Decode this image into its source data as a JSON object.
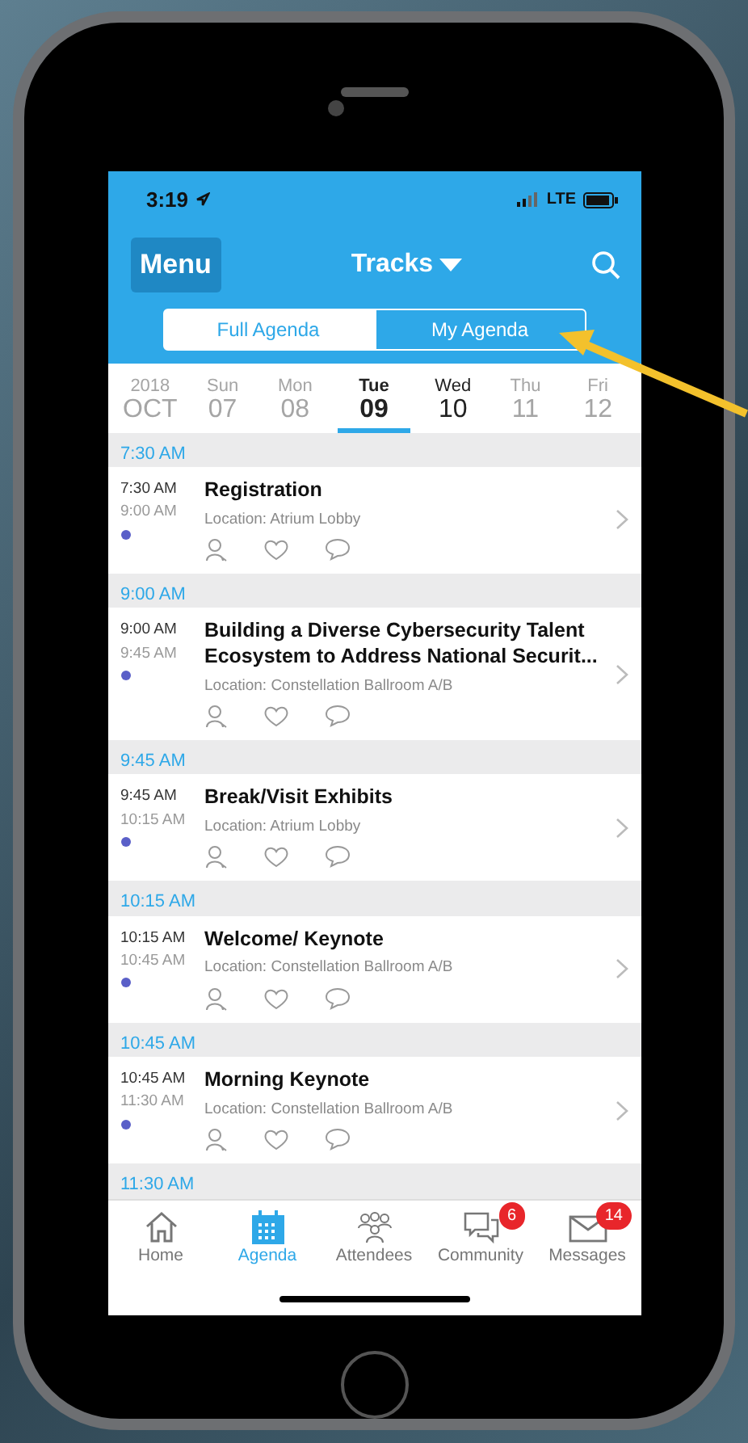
{
  "status_bar": {
    "time": "3:19",
    "network": "LTE"
  },
  "header": {
    "menu_button": "Menu",
    "title": "Tracks"
  },
  "segments": [
    {
      "label": "Full Agenda",
      "selected": true
    },
    {
      "label": "My Agenda",
      "selected": false
    }
  ],
  "date_strip": {
    "year": "2018",
    "month": "OCT",
    "days": [
      {
        "weekday": "Sun",
        "day": "07",
        "selected": false,
        "has_events": false
      },
      {
        "weekday": "Mon",
        "day": "08",
        "selected": false,
        "has_events": false
      },
      {
        "weekday": "Tue",
        "day": "09",
        "selected": true,
        "has_events": true
      },
      {
        "weekday": "Wed",
        "day": "10",
        "selected": false,
        "has_events": true
      },
      {
        "weekday": "Thu",
        "day": "11",
        "selected": false,
        "has_events": false
      },
      {
        "weekday": "Fri",
        "day": "12",
        "selected": false,
        "has_events": false
      }
    ]
  },
  "sections": [
    {
      "time": "7:30 AM",
      "sessions": [
        {
          "start": "7:30 AM",
          "end": "9:00 AM",
          "title": "Registration",
          "location": "Location: Atrium Lobby"
        }
      ]
    },
    {
      "time": "9:00 AM",
      "sessions": [
        {
          "start": "9:00 AM",
          "end": "9:45 AM",
          "title": "Building a Diverse Cybersecurity Talent Ecosystem to Address National Securit...",
          "location": "Location: Constellation Ballroom A/B"
        }
      ]
    },
    {
      "time": "9:45 AM",
      "sessions": [
        {
          "start": "9:45 AM",
          "end": "10:15 AM",
          "title": "Break/Visit Exhibits",
          "location": "Location: Atrium Lobby"
        }
      ]
    },
    {
      "time": "10:15 AM",
      "sessions": [
        {
          "start": "10:15 AM",
          "end": "10:45 AM",
          "title": "Welcome/ Keynote",
          "location": "Location: Constellation Ballroom A/B"
        }
      ]
    },
    {
      "time": "10:45 AM",
      "sessions": [
        {
          "start": "10:45 AM",
          "end": "11:30 AM",
          "title": "Morning Keynote",
          "location": "Location: Constellation Ballroom A/B"
        }
      ]
    },
    {
      "time": "11:30 AM"
    }
  ],
  "tab_bar": [
    {
      "kind": "home",
      "label": "Home",
      "selected": false
    },
    {
      "kind": "agenda",
      "label": "Agenda",
      "selected": true
    },
    {
      "kind": "attendees",
      "label": "Attendees",
      "selected": false
    },
    {
      "kind": "community",
      "label": "Community",
      "selected": false,
      "badge": "6"
    },
    {
      "kind": "messages",
      "label": "Messages",
      "selected": false,
      "badge": "14"
    }
  ]
}
